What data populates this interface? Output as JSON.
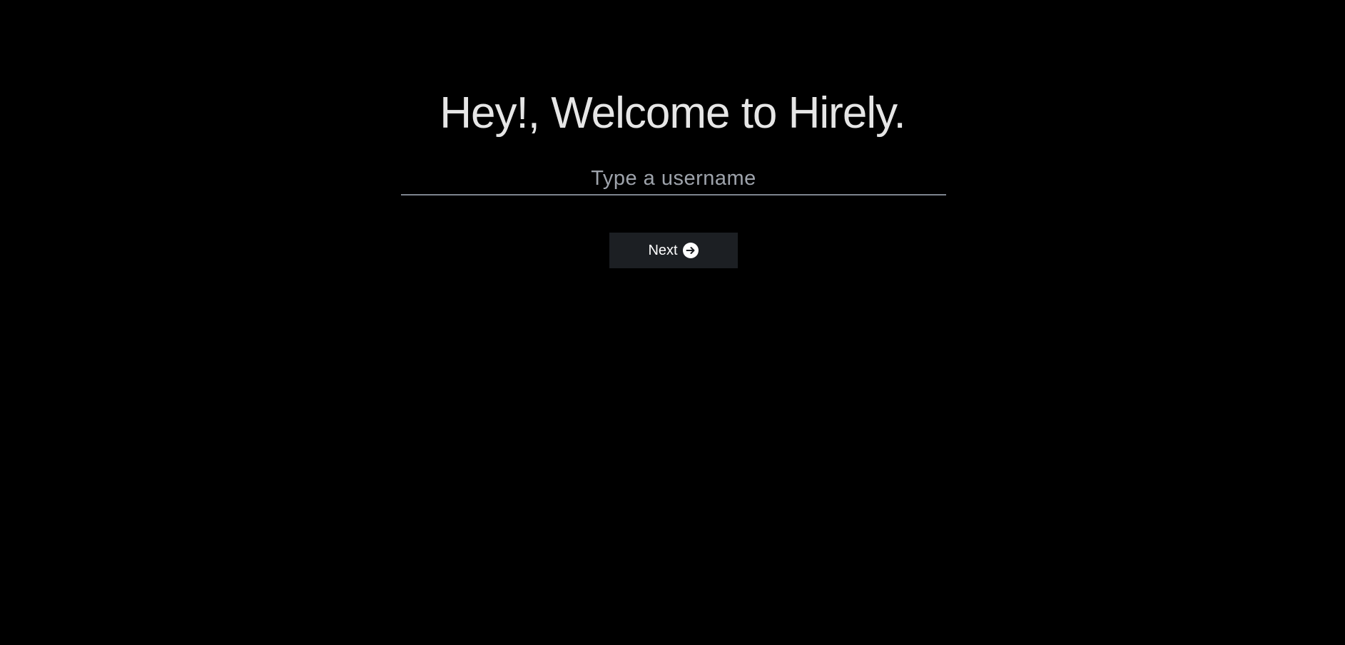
{
  "welcome": {
    "title": "Hey!, Welcome to Hirely."
  },
  "username": {
    "value": "",
    "placeholder": "Type a username"
  },
  "next_button": {
    "label": "Next",
    "icon": "arrow-right-circle-icon"
  },
  "colors": {
    "background": "#000000",
    "title_text": "#e6e6e6",
    "placeholder_text": "#9ea3ab",
    "underline": "#7d848e",
    "button_bg": "#1c1f23",
    "button_text": "#ffffff"
  }
}
